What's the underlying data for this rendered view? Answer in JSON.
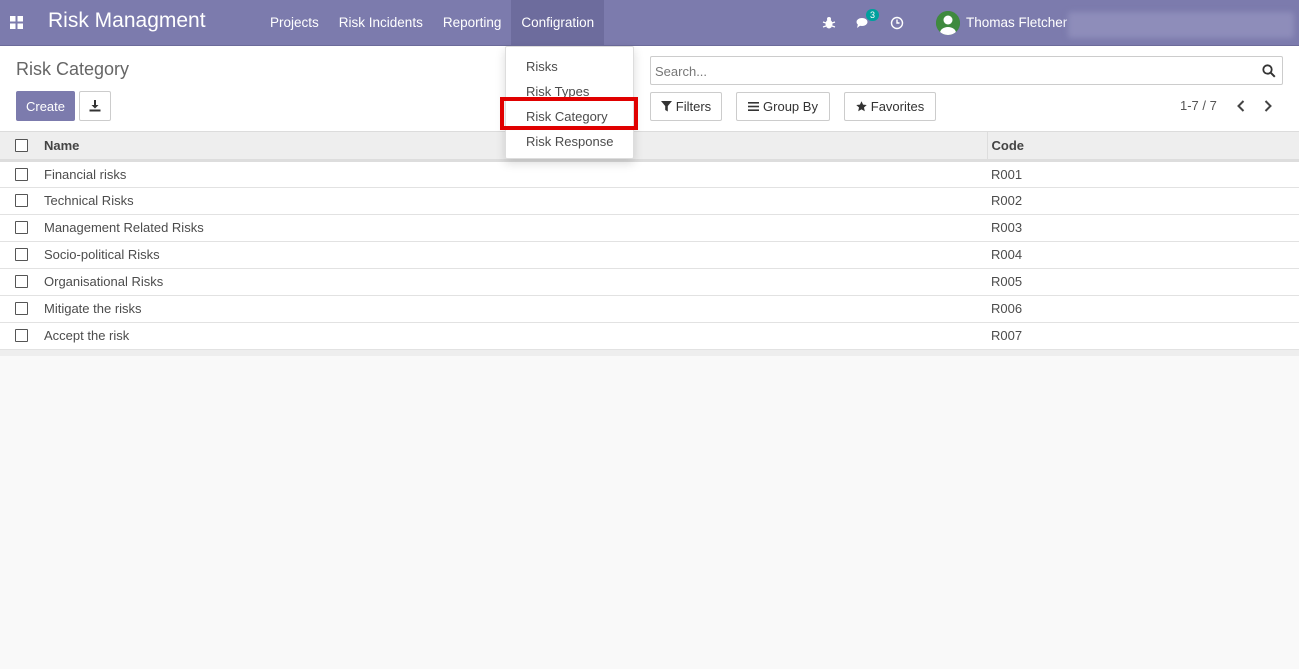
{
  "navbar": {
    "brand": "Risk Managment",
    "menu": [
      {
        "label": "Projects"
      },
      {
        "label": "Risk Incidents"
      },
      {
        "label": "Reporting"
      },
      {
        "label": "Configration",
        "active": true
      }
    ],
    "messages_count": "3",
    "user_name": "Thomas Fletcher"
  },
  "dropdown": {
    "items": [
      "Risks",
      "Risk Types",
      "Risk Category",
      "Risk Response"
    ],
    "highlighted": "Risk Category"
  },
  "control_panel": {
    "title": "Risk Category",
    "create_label": "Create",
    "search_placeholder": "Search...",
    "filters_label": "Filters",
    "group_by_label": "Group By",
    "favorites_label": "Favorites",
    "pager": "1-7 / 7"
  },
  "table": {
    "headers": {
      "name": "Name",
      "code": "Code"
    },
    "rows": [
      {
        "name": "Financial risks",
        "code": "R001"
      },
      {
        "name": "Technical Risks",
        "code": "R002"
      },
      {
        "name": "Management Related Risks",
        "code": "R003"
      },
      {
        "name": "Socio-political Risks",
        "code": "R004"
      },
      {
        "name": "Organisational Risks",
        "code": "R005"
      },
      {
        "name": "Mitigate the risks",
        "code": "R006"
      },
      {
        "name": "Accept the risk",
        "code": "R007"
      }
    ]
  },
  "colors": {
    "navbar": "#7c7bad",
    "highlight_box": "#e00000",
    "badge": "#00a09d"
  }
}
